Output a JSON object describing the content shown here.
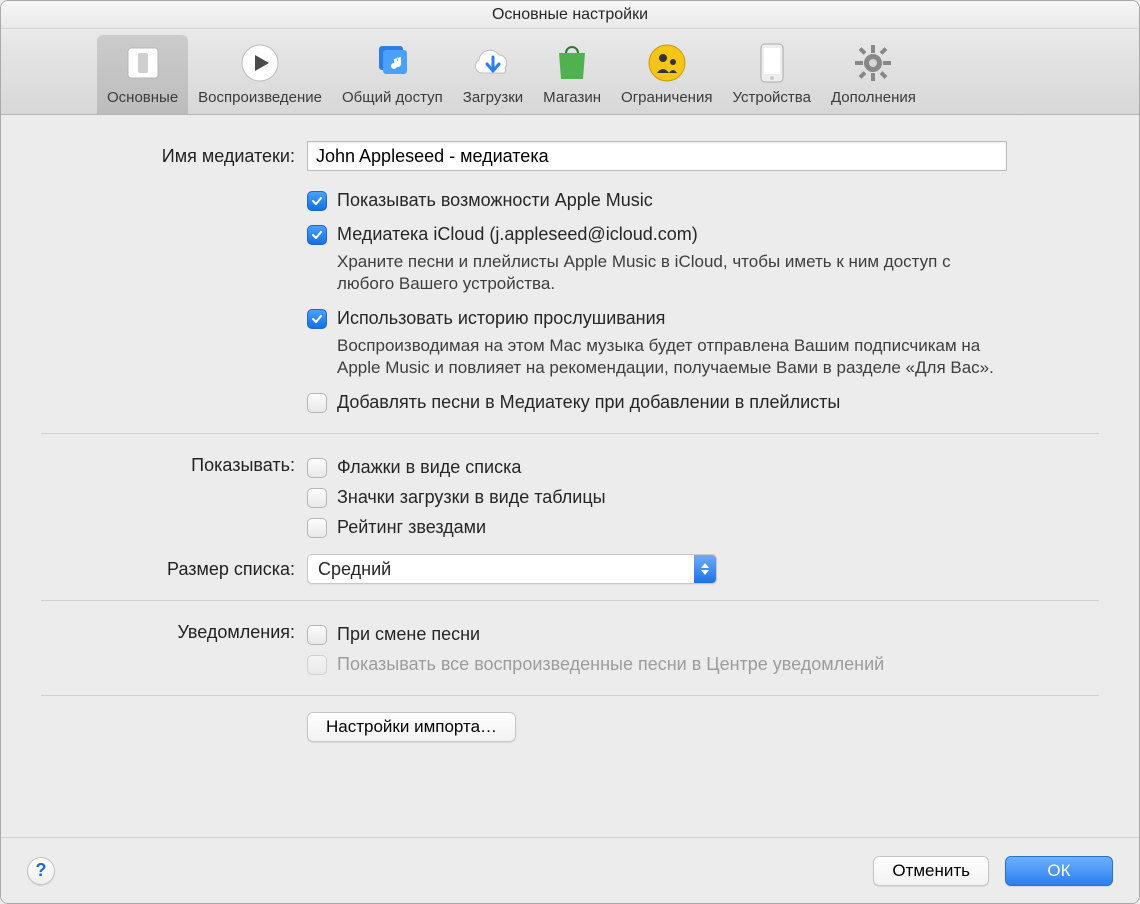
{
  "window": {
    "title": "Основные настройки"
  },
  "tabs": [
    {
      "label": "Основные"
    },
    {
      "label": "Воспроизведение"
    },
    {
      "label": "Общий доступ"
    },
    {
      "label": "Загрузки"
    },
    {
      "label": "Магазин"
    },
    {
      "label": "Ограничения"
    },
    {
      "label": "Устройства"
    },
    {
      "label": "Дополнения"
    }
  ],
  "library": {
    "name_label": "Имя медиатеки:",
    "name_value": "John Appleseed - медиатека"
  },
  "optionsA": {
    "show_am": "Показывать возможности Apple Music",
    "icloud_lib": "Медиатека iCloud (j.appleseed@icloud.com)",
    "icloud_desc": "Храните песни и плейлисты Apple Music в iCloud, чтобы иметь к ним доступ с любого Вашего устройства.",
    "history": "Использовать историю прослушивания",
    "history_desc": "Воспроизводимая на этом Mac музыка будет отправлена Вашим подписчикам на Apple Music и повлияет на рекомендации, получаемые Вами в разделе «Для Вас».",
    "add_songs": "Добавлять песни в Медиатеку при добавлении в плейлисты"
  },
  "show_section": {
    "label": "Показывать:",
    "flags": "Флажки в виде списка",
    "dl_icons": "Значки загрузки в виде таблицы",
    "star": "Рейтинг звездами"
  },
  "list_size": {
    "label": "Размер списка:",
    "value": "Средний"
  },
  "notify": {
    "label": "Уведомления:",
    "on_change": "При смене песни",
    "show_all": "Показывать все воспроизведенные песни в Центре уведомлений"
  },
  "import_button": "Настройки импорта…",
  "footer": {
    "cancel": "Отменить",
    "ok": "ОК"
  },
  "help": "?"
}
